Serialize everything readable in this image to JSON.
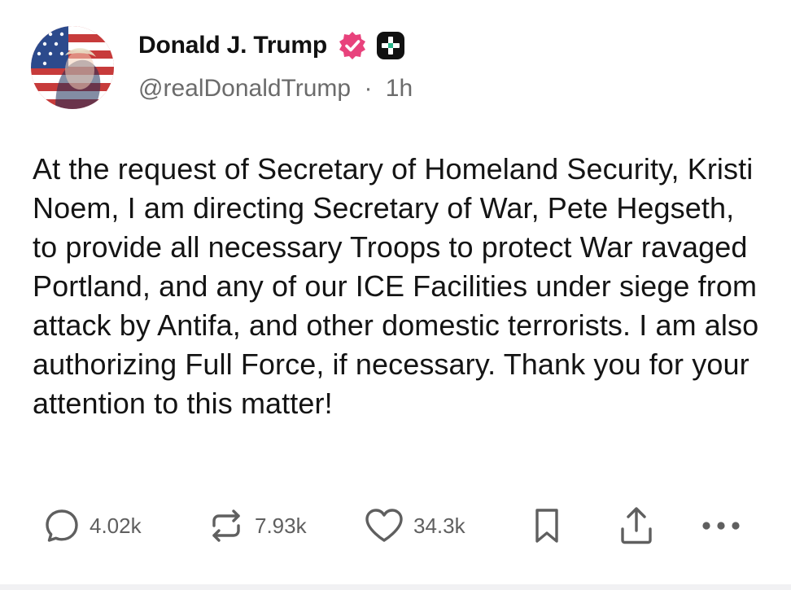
{
  "post": {
    "author": {
      "display_name": "Donald J. Trump",
      "handle": "@realDonaldTrump",
      "separator": "·",
      "time_ago": "1h",
      "verified_icon": "verified-badge-icon",
      "verified_color": "#e8427c",
      "plus_badge_icon": "plus-badge-icon"
    },
    "body": "At the request of Secretary of Homeland Security, Kristi Noem, I am directing Secretary of War, Pete Hegseth, to provide all necessary Troops to protect War ravaged Portland, and any of our ICE Facilities under siege from attack by Antifa, and other domestic terrorists. I am also authorizing Full Force, if necessary. Thank you for your attention to this matter!",
    "actions": {
      "replies": {
        "icon": "reply-icon",
        "count": "4.02k"
      },
      "reposts": {
        "icon": "repost-icon",
        "count": "7.93k"
      },
      "likes": {
        "icon": "heart-icon",
        "count": "34.3k"
      },
      "bookmark": {
        "icon": "bookmark-icon"
      },
      "share": {
        "icon": "share-icon"
      },
      "more": {
        "icon": "more-icon"
      }
    }
  }
}
